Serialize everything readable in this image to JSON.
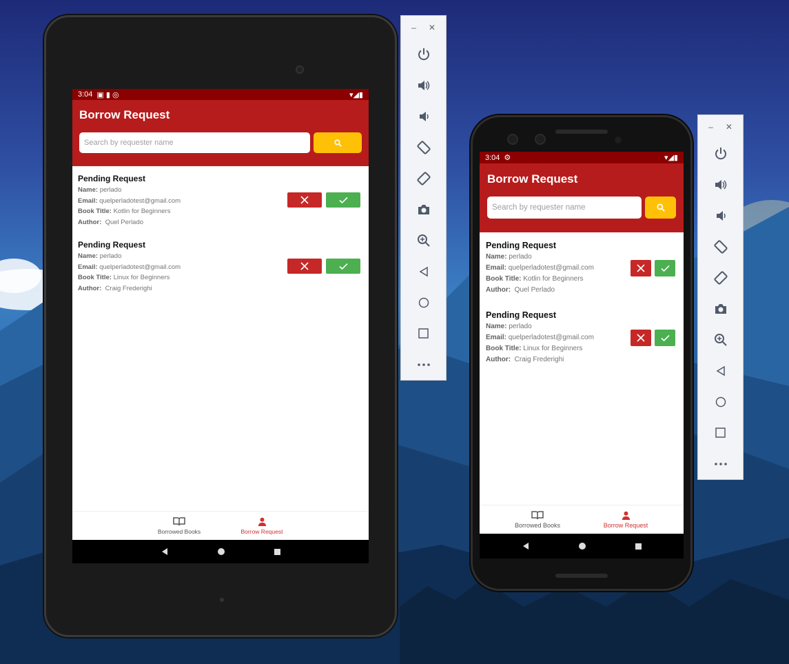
{
  "colors": {
    "primary": "#b71c1c",
    "status_bar": "#8b0000",
    "search_button": "#ffc107",
    "reject": "#c62828",
    "accept": "#4caf50",
    "nav_active": "#d32f2f"
  },
  "tablet": {
    "status_time": "3:04",
    "title": "Borrow Request",
    "search_placeholder": "Search by requester name",
    "requests": [
      {
        "heading": "Pending Request",
        "name_label": "Name:",
        "name": "perlado",
        "email_label": "Email:",
        "email": "quelperladotest@gmail.com",
        "book_label": "Book Title:",
        "book": "Kotlin for Beginners",
        "author_label": "Author:",
        "author": "Quel Perlado"
      },
      {
        "heading": "Pending Request",
        "name_label": "Name:",
        "name": "perlado",
        "email_label": "Email:",
        "email": "quelperladotest@gmail.com",
        "book_label": "Book Title:",
        "book": "Linux for Beginners",
        "author_label": "Author:",
        "author": "Craig Frederighi"
      }
    ],
    "nav": {
      "borrowed": "Borrowed Books",
      "request": "Borrow Request"
    }
  },
  "phone": {
    "status_time": "3:04",
    "title": "Borrow Request",
    "search_placeholder": "Search by requester name",
    "requests": [
      {
        "heading": "Pending Request",
        "name_label": "Name:",
        "name": "perlado",
        "email_label": "Email:",
        "email": "quelperladotest@gmail.com",
        "book_label": "Book Title:",
        "book": "Kotlin for Beginners",
        "author_label": "Author:",
        "author": "Quel Perlado"
      },
      {
        "heading": "Pending Request",
        "name_label": "Name:",
        "name": "perlado",
        "email_label": "Email:",
        "email": "quelperladotest@gmail.com",
        "book_label": "Book Title:",
        "book": "Linux for Beginners",
        "author_label": "Author:",
        "author": "Craig Frederighi"
      }
    ],
    "nav": {
      "borrowed": "Borrowed Books",
      "request": "Borrow Request"
    }
  },
  "emulator_toolbar": {
    "items": [
      "power-icon",
      "volume-up-icon",
      "volume-down-icon",
      "rotate-left-icon",
      "rotate-right-icon",
      "screenshot-icon",
      "zoom-icon",
      "back-icon",
      "home-icon",
      "overview-icon",
      "more-icon"
    ]
  }
}
